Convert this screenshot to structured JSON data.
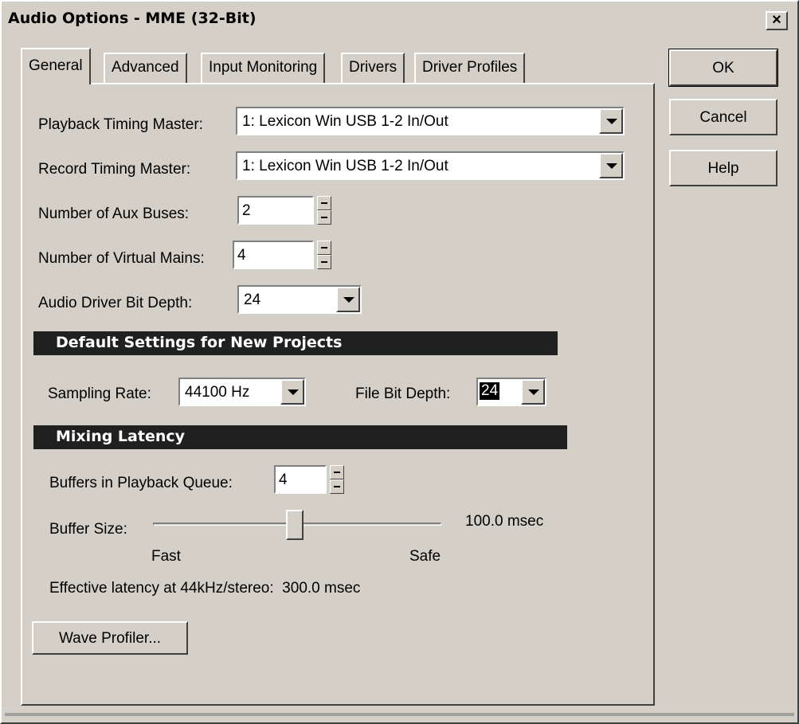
{
  "window": {
    "title": "Audio Options - MME (32-Bit)",
    "close_label": "×"
  },
  "tabs": [
    {
      "label": "General",
      "active": true
    },
    {
      "label": "Advanced",
      "active": false
    },
    {
      "label": "Input Monitoring",
      "active": false
    },
    {
      "label": "Drivers",
      "active": false
    },
    {
      "label": "Driver Profiles",
      "active": false
    }
  ],
  "buttons": {
    "ok": "OK",
    "cancel": "Cancel",
    "help": "Help"
  },
  "general": {
    "playback_timing_master": {
      "label": "Playback Timing Master:",
      "value": "1: Lexicon Win USB 1-2 In/Out"
    },
    "record_timing_master": {
      "label": "Record Timing Master:",
      "value": "1: Lexicon Win USB 1-2 In/Out"
    },
    "aux_buses": {
      "label": "Number of Aux Buses:",
      "value": "2"
    },
    "virtual_mains": {
      "label": "Number of Virtual Mains:",
      "value": "4"
    },
    "driver_bit_depth": {
      "label": "Audio Driver Bit Depth:",
      "value": "24"
    }
  },
  "defaults_section": {
    "heading": "Default Settings for New Projects",
    "sampling_rate": {
      "label": "Sampling Rate:",
      "value": "44100 Hz"
    },
    "file_bit_depth": {
      "label": "File Bit Depth:",
      "value": "24"
    }
  },
  "latency_section": {
    "heading": "Mixing Latency",
    "buffers": {
      "label": "Buffers in Playback Queue:",
      "value": "4"
    },
    "buffer_size": {
      "label": "Buffer Size:",
      "readout": "100.0 msec",
      "min_label": "Fast",
      "max_label": "Safe",
      "position_fraction": 0.49
    },
    "effective_latency": "Effective latency at 44kHz/stereo:  300.0 msec",
    "wave_profiler": "Wave Profiler..."
  },
  "colors": {
    "face": "#d4d0c8",
    "section_bg": "#202020",
    "section_text": "#ffffff"
  }
}
